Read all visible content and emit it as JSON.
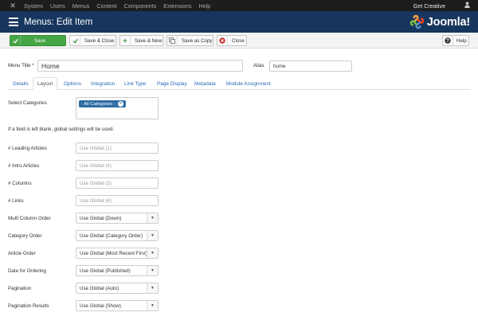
{
  "topbar": {
    "menu": [
      "System",
      "Users",
      "Menus",
      "Content",
      "Components",
      "Extensions",
      "Help"
    ],
    "site_link": "Get Creative",
    "user_icon": "user-icon",
    "logo_icon": "joomla-small-icon"
  },
  "header": {
    "title": "Menus: Edit Item",
    "brand": "Joomla!",
    "page_icon": "list-icon"
  },
  "toolbar": {
    "save": "Save",
    "save_close": "Save & Close",
    "save_new": "Save & New",
    "save_copy": "Save as Copy",
    "close": "Close",
    "help": "Help"
  },
  "form": {
    "menu_title_label": "Menu Title *",
    "menu_title_value": "Home",
    "alias_label": "Alias",
    "alias_value": "home"
  },
  "tabs": [
    "Details",
    "Layout",
    "Options",
    "Integration",
    "Link Type",
    "Page Display",
    "Metadata",
    "Module Assignment"
  ],
  "active_tab": "Layout",
  "layout": {
    "select_categories_label": "Select Categories",
    "category_chip": "- All Categories -",
    "hint": "If a field is left blank, global settings will be used.",
    "leading_label": "# Leading Articles",
    "leading_placeholder": "Use Global (1)",
    "intro_label": "# Intro Articles",
    "intro_placeholder": "Use Global (4)",
    "columns_label": "# Columns",
    "columns_placeholder": "Use Global (2)",
    "links_label": "# Links",
    "links_placeholder": "Use Global (4)",
    "multi_col_label": "Multi Column Order",
    "multi_col_value": "Use Global (Down)",
    "cat_order_label": "Category Order",
    "cat_order_value": "Use Global (Category Order)",
    "art_order_label": "Article Order",
    "art_order_value": "Use Global (Most Recent First)",
    "date_label": "Date for Ordering",
    "date_value": "Use Global (Published)",
    "pagination_label": "Pagination",
    "pagination_value": "Use Global (Auto)",
    "pag_results_label": "Pagination Results",
    "pag_results_value": "Use Global (Show)"
  },
  "colors": {
    "topbar": "#1d1d1d",
    "header": "#17365e",
    "save_button": "#46a546",
    "link": "#2a69b8",
    "chip": "#2d6ca2"
  }
}
